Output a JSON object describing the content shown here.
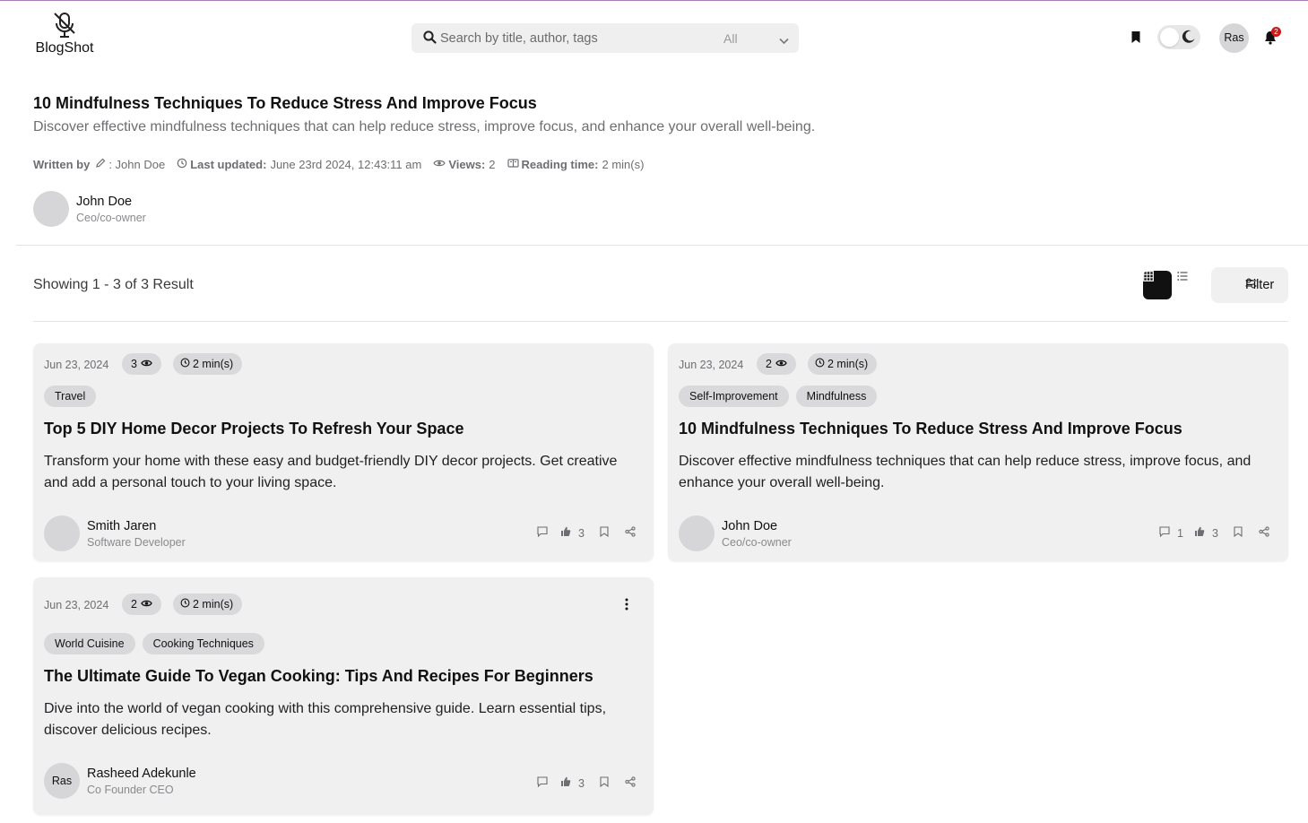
{
  "header": {
    "logo_text": "BlogShot",
    "search_placeholder": "Search by title, author, tags",
    "search_category": "All",
    "avatar_initials": "Ras",
    "notification_count": "2"
  },
  "post": {
    "title": "10 Mindfulness Techniques To Reduce Stress And Improve Focus",
    "description": "Discover effective mindfulness techniques that can help reduce stress, improve focus, and enhance your overall well-being.",
    "written_by_label": "Written by",
    "author_sep": ": John Doe",
    "last_updated_label": "Last updated:",
    "last_updated_value": "June 23rd 2024, 12:43:11 am",
    "views_label": "Views:",
    "views_value": "2",
    "reading_label": "Reading time:",
    "reading_value": "2 min(s)",
    "author_name": "John Doe",
    "author_role": "Ceo/co-owner"
  },
  "results": {
    "showing_text": "Showing 1 - 3 of 3 Result",
    "filter_label": "Filter"
  },
  "cards": [
    {
      "date": "Jun 23, 2024",
      "views": "3",
      "reading": "2 min(s)",
      "tags": [
        "Travel"
      ],
      "title": "Top 5 DIY Home Decor Projects To Refresh Your Space",
      "description": "Transform your home with these easy and budget-friendly DIY decor projects. Get creative and add a personal touch to your living space.",
      "author_initials": "",
      "author_name": "Smith Jaren",
      "author_role": "Software Developer",
      "comments": "",
      "likes": "3"
    },
    {
      "date": "Jun 23, 2024",
      "views": "2",
      "reading": "2 min(s)",
      "tags": [
        "Self-Improvement",
        "Mindfulness"
      ],
      "title": "10 Mindfulness Techniques To Reduce Stress And Improve Focus",
      "description": "Discover effective mindfulness techniques that can help reduce stress, improve focus, and enhance your overall well-being.",
      "author_initials": "",
      "author_name": "John Doe",
      "author_role": "Ceo/co-owner",
      "comments": "1",
      "likes": "3"
    },
    {
      "date": "Jun 23, 2024",
      "views": "2",
      "reading": "2 min(s)",
      "tags": [
        "World Cuisine",
        "Cooking Techniques"
      ],
      "title": "The Ultimate Guide To Vegan Cooking: Tips And Recipes For Beginners",
      "description": "Dive into the world of vegan cooking with this comprehensive guide. Learn essential tips, discover delicious recipes.",
      "author_initials": "Ras",
      "author_name": "Rasheed Adekunle",
      "author_role": "Co Founder CEO",
      "comments": "",
      "likes": "3"
    }
  ],
  "icons": {
    "logo": "microphone-off-icon",
    "search": "search-icon",
    "bookmark": "bookmark-icon",
    "theme": "moon-icon",
    "notifications": "bell-icon",
    "grid": "grid-view-icon",
    "list": "list-view-icon",
    "filter": "sliders-icon",
    "comment": "comment-icon",
    "like": "thumbs-up-icon",
    "share": "share-icon",
    "more": "kebab-menu-icon"
  },
  "colors": {
    "accent_dark": "#111111",
    "card_bg": "#f0f0f0",
    "pill_bg": "#d9d9dc",
    "badge_red": "#d01818"
  }
}
